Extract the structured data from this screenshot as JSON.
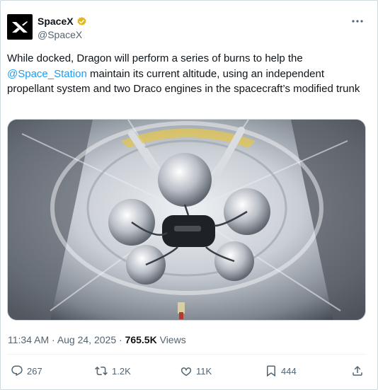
{
  "author": {
    "display_name": "SpaceX",
    "handle": "@SpaceX",
    "verified": true,
    "avatar_icon": "spacex-x-logo"
  },
  "more_icon": "more-dots-icon",
  "tweet": {
    "text_before": "While docked, Dragon will perform a series of burns to help the ",
    "mention": "@Space_Station",
    "text_after": " maintain its current altitude, using an independent propellant system and two Draco engines in the spacecraft’s modified trunk"
  },
  "media": {
    "kind": "photo",
    "subject": "Dragon trunk interior with propellant tanks"
  },
  "meta": {
    "time": "11:34 AM",
    "separator": "·",
    "date": "Aug 24, 2025",
    "views_count": "765.5K",
    "views_label": "Views"
  },
  "actions": {
    "replies": "267",
    "reposts": "1.2K",
    "likes": "11K",
    "bookmarks": "444"
  },
  "colors": {
    "link": "#1d9bf0",
    "muted": "#536471",
    "verified_badge": "#e2b719"
  }
}
